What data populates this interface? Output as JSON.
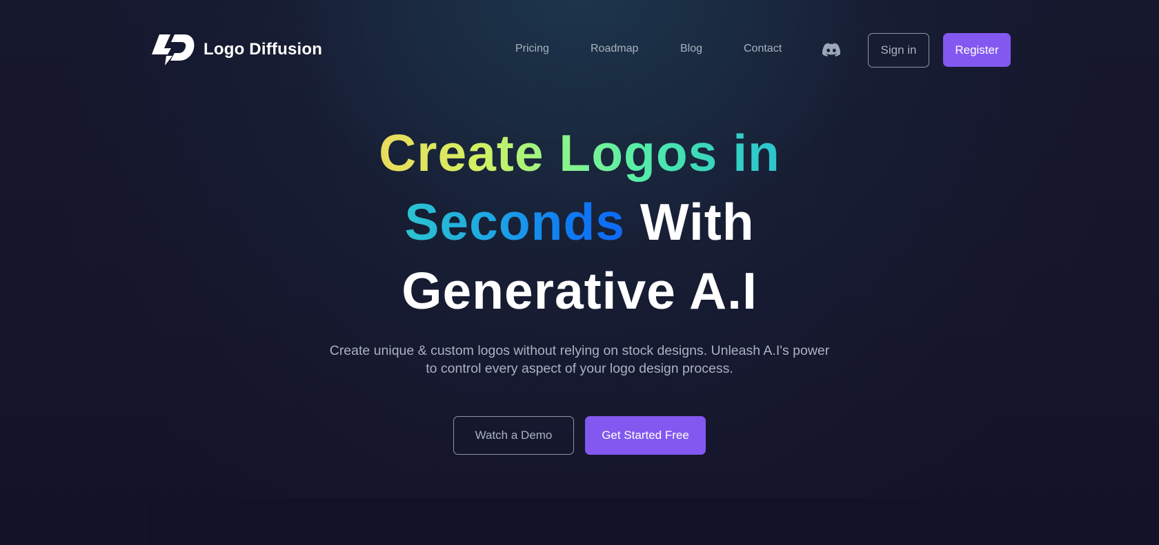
{
  "brand": {
    "name": "Logo Diffusion",
    "logo_icon": "logo-diffusion-bolt-icon"
  },
  "nav": {
    "links": [
      {
        "label": "Pricing"
      },
      {
        "label": "Roadmap"
      },
      {
        "label": "Blog"
      },
      {
        "label": "Contact"
      }
    ],
    "discord_icon": "discord-icon",
    "sign_in_label": "Sign in",
    "register_label": "Register"
  },
  "hero": {
    "headline": {
      "line1_gradient": "Create Logos in",
      "line2_gradient": "Seconds",
      "line2_plain": "With",
      "line3_plain": "Generative A.I"
    },
    "subtitle_line1": "Create unique & custom logos without relying on stock designs. Unleash A.I's power",
    "subtitle_line2": "to control every aspect of your logo design process.",
    "secondary_cta": "Watch a Demo",
    "primary_cta": "Get Started Free"
  },
  "colors": {
    "accent": "#8358f0",
    "background": "#141228",
    "nav_text": "#a9b3c1",
    "gradient_stops": [
      "#eadb5c",
      "#8ef58a",
      "#2cc3d0",
      "#0e69f6"
    ]
  }
}
